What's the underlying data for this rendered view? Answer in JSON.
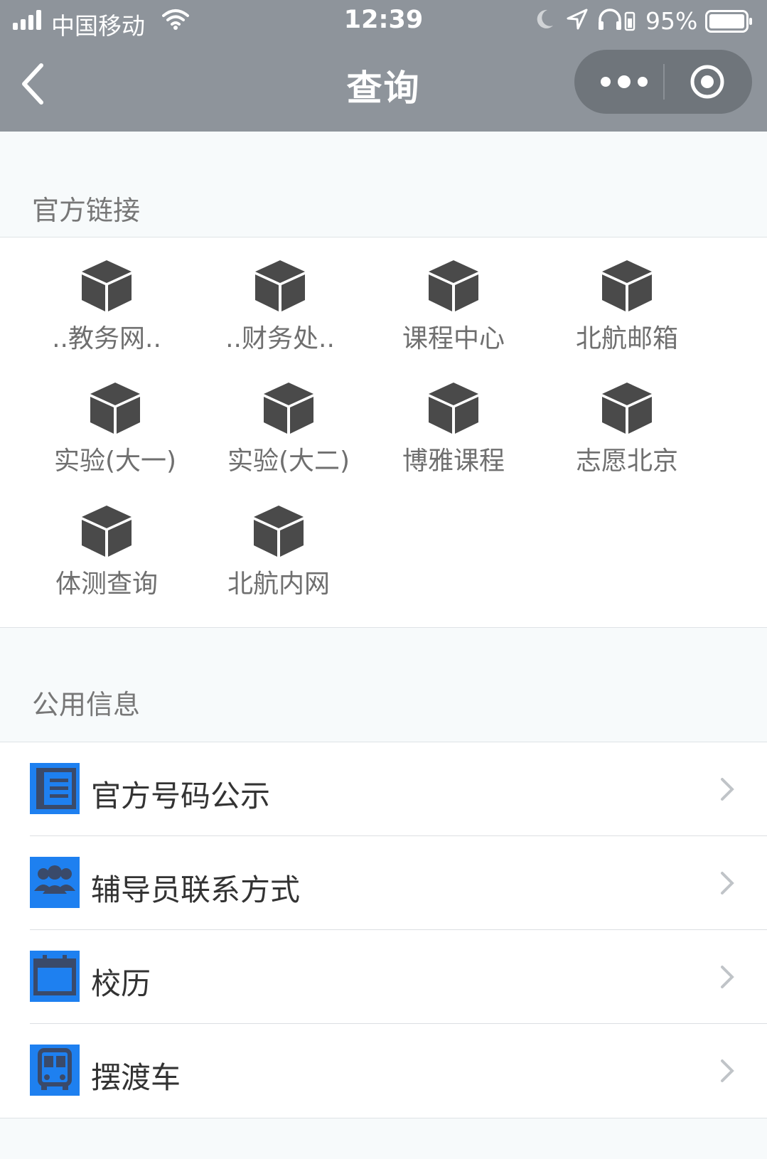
{
  "status": {
    "carrier": "中国移动",
    "time": "12:39",
    "battery": "95%"
  },
  "nav": {
    "title": "查询"
  },
  "official_links": {
    "label": "官方链接",
    "items": [
      {
        "label": "..教务网.."
      },
      {
        "label": "..财务处.."
      },
      {
        "label": "课程中心"
      },
      {
        "label": "北航邮箱"
      },
      {
        "label": "实验(大一)"
      },
      {
        "label": "实验(大二)"
      },
      {
        "label": "博雅课程"
      },
      {
        "label": "志愿北京"
      },
      {
        "label": "体测查询"
      },
      {
        "label": "北航内网"
      }
    ]
  },
  "public_info": {
    "label": "公用信息",
    "items": [
      {
        "label": "官方号码公示",
        "icon": "document-list-icon"
      },
      {
        "label": "辅导员联系方式",
        "icon": "group-icon"
      },
      {
        "label": "校历",
        "icon": "calendar-icon"
      },
      {
        "label": "摆渡车",
        "icon": "bus-icon"
      }
    ]
  },
  "colors": {
    "nav_bg": "#8e949b",
    "icon_blue": "#1e80f0",
    "cube": "#4a4a4a"
  }
}
